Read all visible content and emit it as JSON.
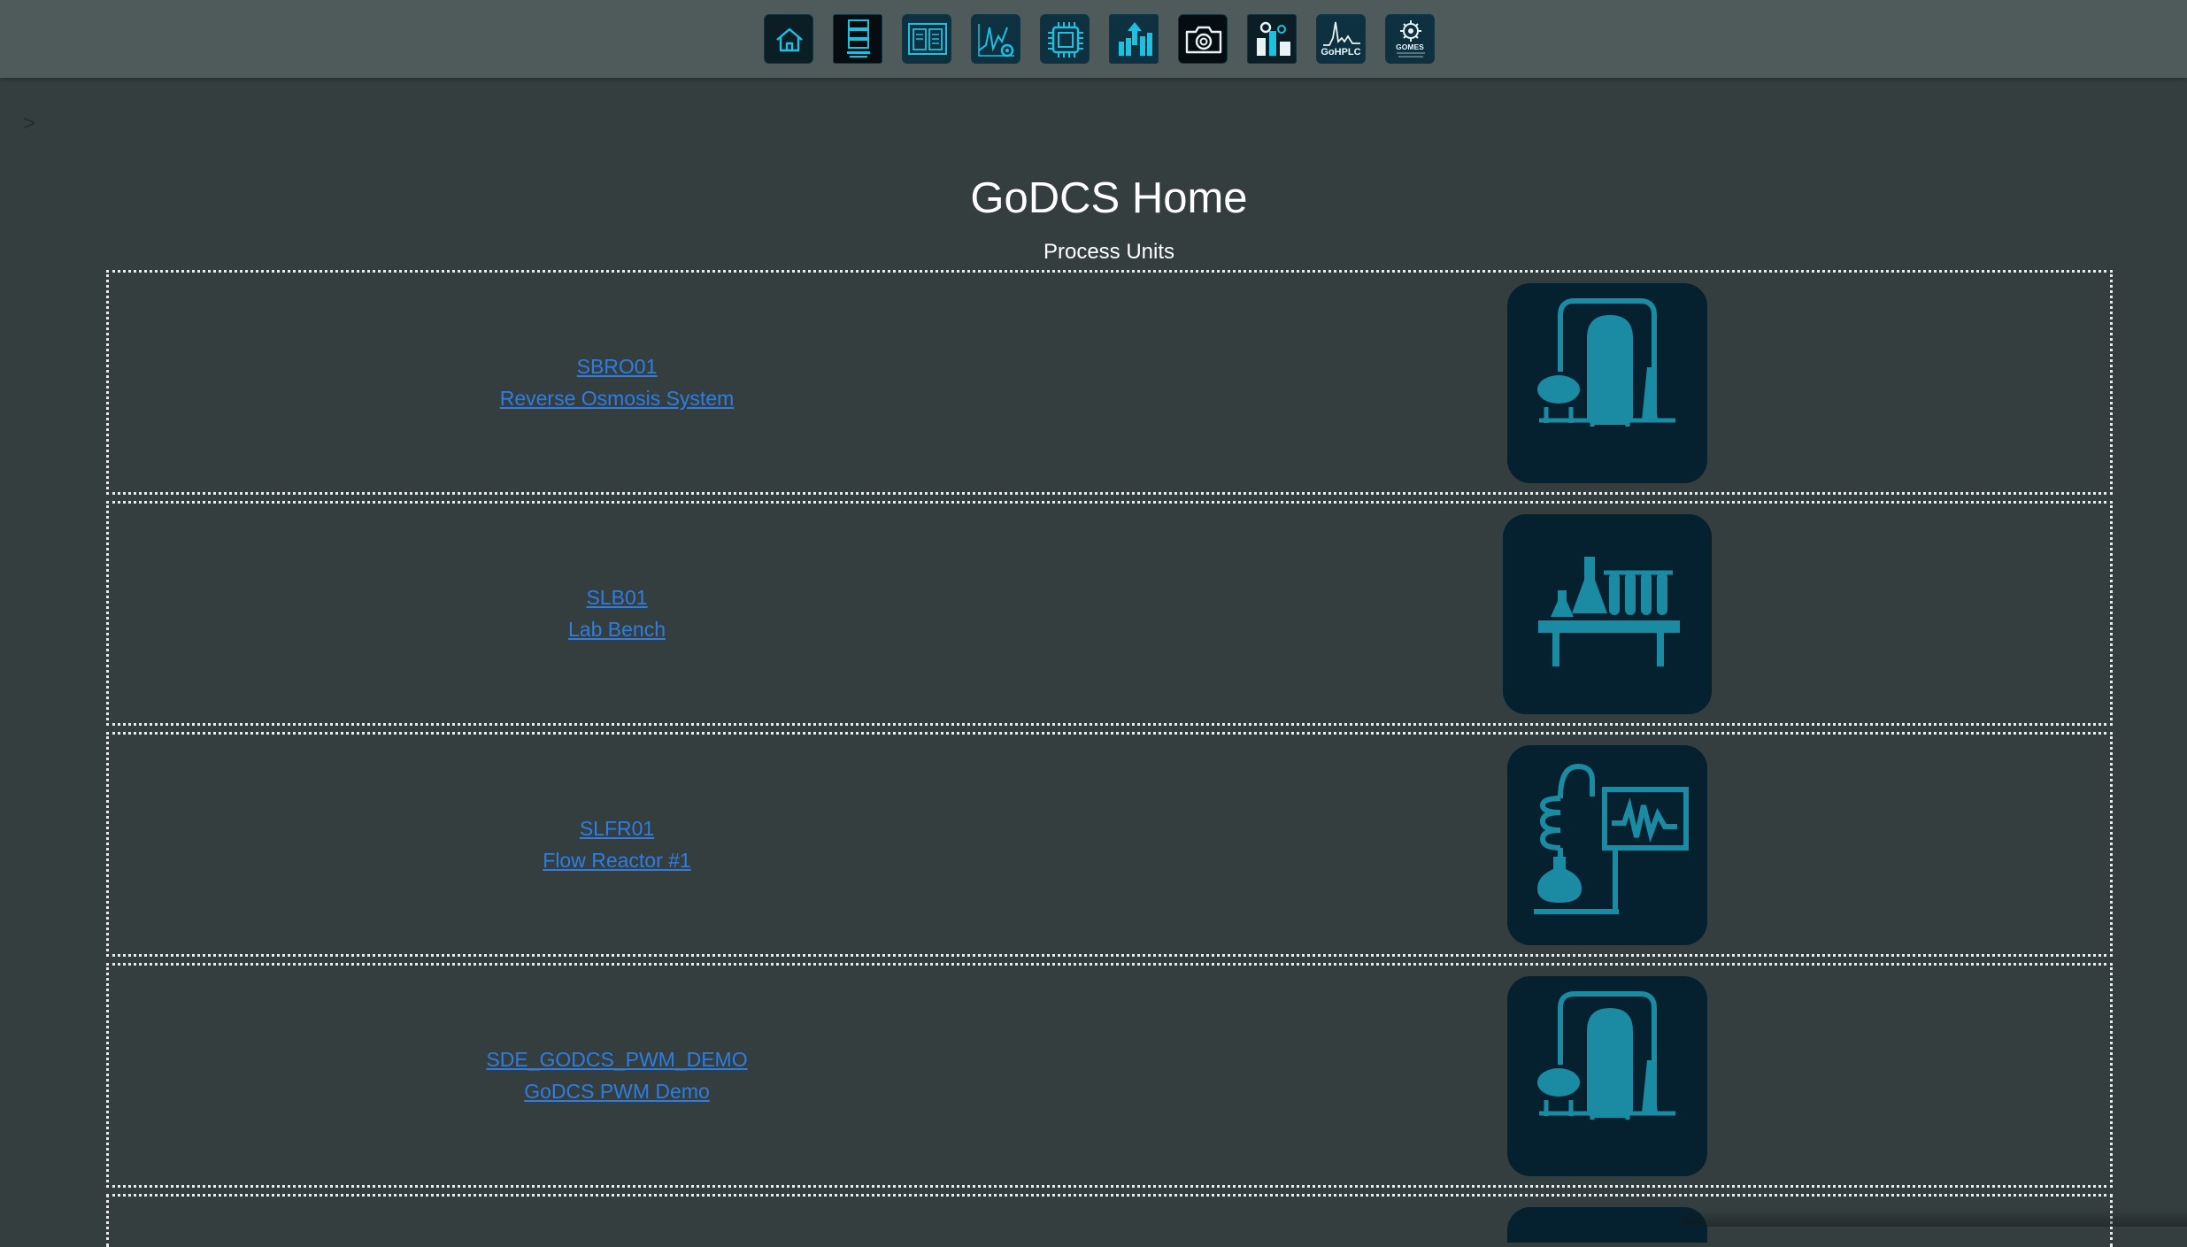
{
  "nav": {
    "icons": [
      {
        "name": "home-icon"
      },
      {
        "name": "modbus-management-icon"
      },
      {
        "name": "manual-book-icon"
      },
      {
        "name": "analytics-settings-icon"
      },
      {
        "name": "chip-icon"
      },
      {
        "name": "upload-chart-icon"
      },
      {
        "name": "camera-icon"
      },
      {
        "name": "plant-settings-icon"
      },
      {
        "name": "gohplc-icon",
        "label": "GoHPLC"
      },
      {
        "name": "gomes-icon",
        "label": "GOMES"
      }
    ]
  },
  "sidebar_toggle": ">",
  "page": {
    "title": "GoDCS Home",
    "subtitle": "Process Units"
  },
  "units": [
    {
      "id": "SBRO01",
      "name": "Reverse Osmosis System",
      "icon": "process-plant-icon"
    },
    {
      "id": "SLB01",
      "name": "Lab Bench",
      "icon": "lab-bench-icon"
    },
    {
      "id": "SLFR01",
      "name": "Flow Reactor #1",
      "icon": "flow-reactor-icon"
    },
    {
      "id": "SDE_GODCS_PWM_DEMO",
      "name": "GoDCS PWM Demo",
      "icon": "process-plant-icon"
    }
  ],
  "colors": {
    "background": "#343e3f",
    "topbar": "#4f5a5b",
    "link": "#2f7de1",
    "icon_accent": "#1b8aa3",
    "icon_tile": "#05212f"
  }
}
